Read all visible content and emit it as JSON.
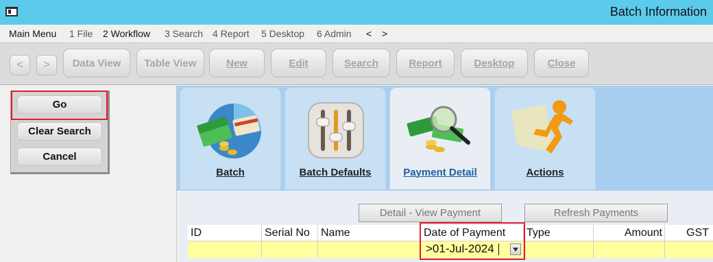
{
  "window": {
    "title": "Batch Information"
  },
  "menu": [
    "Main Menu",
    "1 File",
    "2 Workflow",
    "3 Search",
    "4 Report",
    "5 Desktop",
    "6 Admin",
    "<",
    ">"
  ],
  "toolbar": {
    "back": "<",
    "forward": ">",
    "buttons": [
      "Data View",
      "Table View",
      "New",
      "Edit",
      "Search",
      "Report",
      "Desktop",
      "Close"
    ]
  },
  "search_panel": {
    "go": "Go",
    "clear": "Clear Search",
    "cancel": "Cancel"
  },
  "tabs": [
    {
      "label": "Batch",
      "icon": "money-credit-card-icon"
    },
    {
      "label": "Batch Defaults",
      "icon": "sliders-icon"
    },
    {
      "label": "Payment Detail",
      "icon": "money-magnifier-icon",
      "active": true
    },
    {
      "label": "Actions",
      "icon": "running-man-icon"
    }
  ],
  "actions": {
    "detail_view": "Detail - View Payment",
    "refresh": "Refresh Payments"
  },
  "grid": {
    "columns": [
      "ID",
      "Serial No",
      "Name",
      "Date of Payment",
      "Type",
      "Amount",
      "GST"
    ],
    "date_filter": ">01-Jul-2024"
  },
  "colors": {
    "title_bar": "#5ccbeb",
    "highlight": "#e01e2d",
    "filter_row": "#ffff9e",
    "active_tab_text": "#1d5ea8"
  }
}
